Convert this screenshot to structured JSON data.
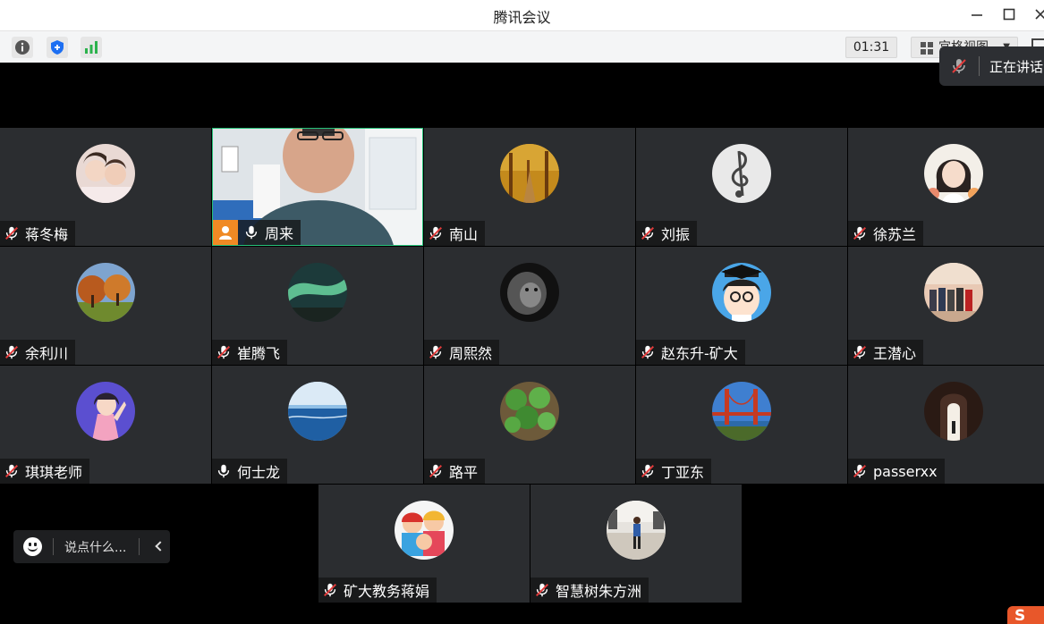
{
  "window": {
    "title": "腾讯会议"
  },
  "toolbar": {
    "timer": "01:31",
    "view_label": "宫格视图"
  },
  "speaking": {
    "label": "正在讲话:"
  },
  "participants": [
    {
      "name": "蒋冬梅",
      "muted": true
    },
    {
      "name": "周来",
      "muted": false,
      "host": true,
      "video": true
    },
    {
      "name": "南山",
      "muted": true
    },
    {
      "name": "刘振",
      "muted": true
    },
    {
      "name": "徐苏兰",
      "muted": true
    },
    {
      "name": "余利川",
      "muted": true
    },
    {
      "name": "崔腾飞",
      "muted": true
    },
    {
      "name": "周熙然",
      "muted": true
    },
    {
      "name": "赵东升-矿大",
      "muted": true
    },
    {
      "name": "王潜心",
      "muted": true
    },
    {
      "name": "琪琪老师",
      "muted": true
    },
    {
      "name": "何士龙",
      "muted": false
    },
    {
      "name": "路平",
      "muted": true
    },
    {
      "name": "丁亚东",
      "muted": true
    },
    {
      "name": "passerxx",
      "muted": true
    },
    {
      "name": "矿大教务蒋娟",
      "muted": true
    },
    {
      "name": "智慧树朱方洲",
      "muted": true
    }
  ],
  "chat": {
    "placeholder": "说点什么..."
  },
  "ime": {
    "logo": "S"
  }
}
